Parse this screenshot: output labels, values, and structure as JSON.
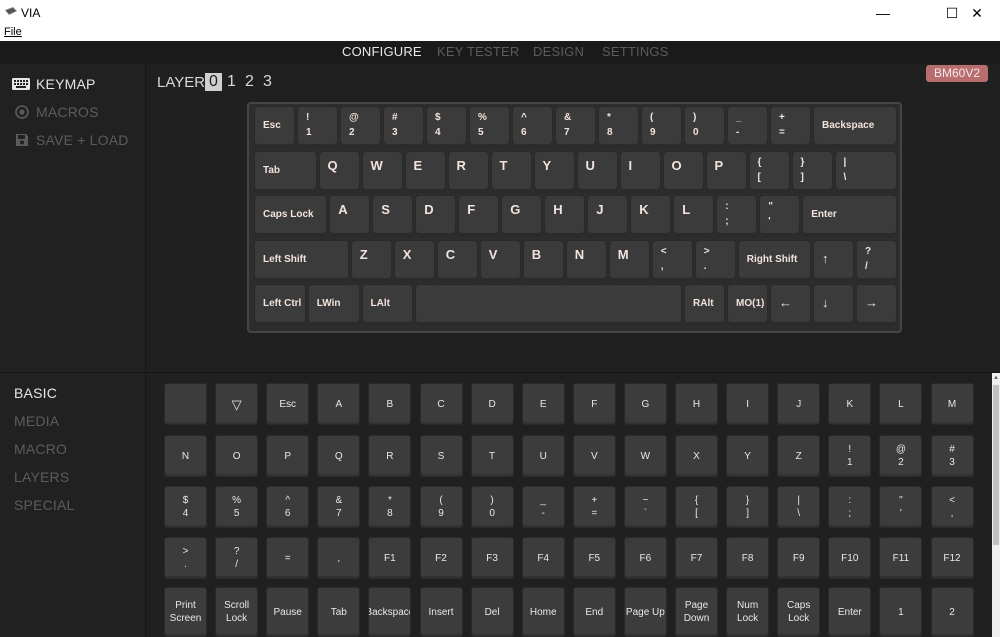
{
  "window": {
    "title": "VIA",
    "minimize": "—",
    "maximize": "☐",
    "close": "✕"
  },
  "menubar": {
    "file": "File"
  },
  "nav": {
    "tabs": [
      {
        "label": "CONFIGURE",
        "active": true
      },
      {
        "label": "KEY TESTER",
        "active": false
      },
      {
        "label": "DESIGN",
        "active": false
      },
      {
        "label": "SETTINGS",
        "active": false
      }
    ]
  },
  "sidebar": {
    "items": [
      {
        "label": "KEYMAP",
        "icon": "keyboard-icon",
        "active": true
      },
      {
        "label": "MACROS",
        "icon": "record-icon",
        "active": false
      },
      {
        "label": "SAVE + LOAD",
        "icon": "save-icon",
        "active": false
      }
    ]
  },
  "layers": {
    "label": "LAYER",
    "items": [
      "0",
      "1",
      "2",
      "3"
    ],
    "selected": "0"
  },
  "device_badge": "BM60V2",
  "keyboard": {
    "rows": [
      [
        [
          "Esc",
          ""
        ],
        [
          "!",
          "1"
        ],
        [
          "@",
          "2"
        ],
        [
          "#",
          "3"
        ],
        [
          "$",
          "4"
        ],
        [
          "%",
          "5"
        ],
        [
          "^",
          "6"
        ],
        [
          "&",
          "7"
        ],
        [
          "*",
          "8"
        ],
        [
          "(",
          "9"
        ],
        [
          ")",
          "0"
        ],
        [
          "_",
          "-"
        ],
        [
          "+",
          "="
        ],
        [
          "Backspace",
          ""
        ]
      ],
      [
        [
          "Tab",
          ""
        ],
        [
          "Q",
          ""
        ],
        [
          "W",
          ""
        ],
        [
          "E",
          ""
        ],
        [
          "R",
          ""
        ],
        [
          "T",
          ""
        ],
        [
          "Y",
          ""
        ],
        [
          "U",
          ""
        ],
        [
          "I",
          ""
        ],
        [
          "O",
          ""
        ],
        [
          "P",
          ""
        ],
        [
          "{",
          "["
        ],
        [
          "}",
          "]"
        ],
        [
          "|",
          "\\"
        ]
      ],
      [
        [
          "Caps Lock",
          ""
        ],
        [
          "A",
          ""
        ],
        [
          "S",
          ""
        ],
        [
          "D",
          ""
        ],
        [
          "F",
          ""
        ],
        [
          "G",
          ""
        ],
        [
          "H",
          ""
        ],
        [
          "J",
          ""
        ],
        [
          "K",
          ""
        ],
        [
          "L",
          ""
        ],
        [
          ":",
          ";"
        ],
        [
          "\"",
          "'"
        ],
        [
          "Enter",
          ""
        ]
      ],
      [
        [
          "Left Shift",
          ""
        ],
        [
          "Z",
          ""
        ],
        [
          "X",
          ""
        ],
        [
          "C",
          ""
        ],
        [
          "V",
          ""
        ],
        [
          "B",
          ""
        ],
        [
          "N",
          ""
        ],
        [
          "M",
          ""
        ],
        [
          "<",
          ","
        ],
        [
          ">",
          "."
        ],
        [
          "Right Shift",
          ""
        ],
        [
          "↑",
          ""
        ],
        [
          "?",
          "/"
        ]
      ],
      [
        [
          "Left Ctrl",
          ""
        ],
        [
          "LWin",
          ""
        ],
        [
          "LAlt",
          ""
        ],
        [
          "",
          ""
        ],
        [
          "RAlt",
          ""
        ],
        [
          "MO(1)",
          ""
        ],
        [
          "←",
          ""
        ],
        [
          "↓",
          ""
        ],
        [
          "→",
          ""
        ]
      ]
    ]
  },
  "categories": {
    "items": [
      {
        "label": "BASIC",
        "active": true
      },
      {
        "label": "MEDIA",
        "active": false
      },
      {
        "label": "MACRO",
        "active": false
      },
      {
        "label": "LAYERS",
        "active": false
      },
      {
        "label": "SPECIAL",
        "active": false
      }
    ]
  },
  "palette": {
    "rows": [
      [
        [
          "",
          ""
        ],
        [
          "▽",
          ""
        ],
        [
          "Esc",
          ""
        ],
        [
          "A",
          ""
        ],
        [
          "B",
          ""
        ],
        [
          "C",
          ""
        ],
        [
          "D",
          ""
        ],
        [
          "E",
          ""
        ],
        [
          "F",
          ""
        ],
        [
          "G",
          ""
        ],
        [
          "H",
          ""
        ],
        [
          "I",
          ""
        ],
        [
          "J",
          ""
        ],
        [
          "K",
          ""
        ],
        [
          "L",
          ""
        ],
        [
          "M",
          ""
        ]
      ],
      [
        [
          "N",
          ""
        ],
        [
          "O",
          ""
        ],
        [
          "P",
          ""
        ],
        [
          "Q",
          ""
        ],
        [
          "R",
          ""
        ],
        [
          "S",
          ""
        ],
        [
          "T",
          ""
        ],
        [
          "U",
          ""
        ],
        [
          "V",
          ""
        ],
        [
          "W",
          ""
        ],
        [
          "X",
          ""
        ],
        [
          "Y",
          ""
        ],
        [
          "Z",
          ""
        ],
        [
          "!",
          "1"
        ],
        [
          "@",
          "2"
        ],
        [
          "#",
          "3"
        ]
      ],
      [
        [
          "$",
          "4"
        ],
        [
          "%",
          "5"
        ],
        [
          "^",
          "6"
        ],
        [
          "&",
          "7"
        ],
        [
          "*",
          "8"
        ],
        [
          "(",
          "9"
        ],
        [
          ")",
          "0"
        ],
        [
          "_",
          "-"
        ],
        [
          "+",
          "="
        ],
        [
          "~",
          "`"
        ],
        [
          "{",
          "["
        ],
        [
          "}",
          "]"
        ],
        [
          "|",
          "\\"
        ],
        [
          ":",
          ";"
        ],
        [
          "\"",
          "'"
        ],
        [
          "<",
          ","
        ]
      ],
      [
        [
          ">",
          "."
        ],
        [
          "?",
          "/"
        ],
        [
          "=",
          ""
        ],
        [
          ",",
          ""
        ],
        [
          "F1",
          ""
        ],
        [
          "F2",
          ""
        ],
        [
          "F3",
          ""
        ],
        [
          "F4",
          ""
        ],
        [
          "F5",
          ""
        ],
        [
          "F6",
          ""
        ],
        [
          "F7",
          ""
        ],
        [
          "F8",
          ""
        ],
        [
          "F9",
          ""
        ],
        [
          "F10",
          ""
        ],
        [
          "F11",
          ""
        ],
        [
          "F12",
          ""
        ]
      ],
      [
        [
          "Print",
          "Screen"
        ],
        [
          "Scroll",
          "Lock"
        ],
        [
          "Pause",
          ""
        ],
        [
          "Tab",
          ""
        ],
        [
          "Backspace",
          ""
        ],
        [
          "Insert",
          ""
        ],
        [
          "Del",
          ""
        ],
        [
          "Home",
          ""
        ],
        [
          "End",
          ""
        ],
        [
          "Page Up",
          ""
        ],
        [
          "Page",
          "Down"
        ],
        [
          "Num",
          "Lock"
        ],
        [
          "Caps",
          "Lock"
        ],
        [
          "Enter",
          ""
        ],
        [
          "1",
          ""
        ],
        [
          "2",
          ""
        ]
      ]
    ]
  },
  "colors": {
    "accent_badge": "#b86d6f",
    "key_legend": "#f2e3dc"
  }
}
